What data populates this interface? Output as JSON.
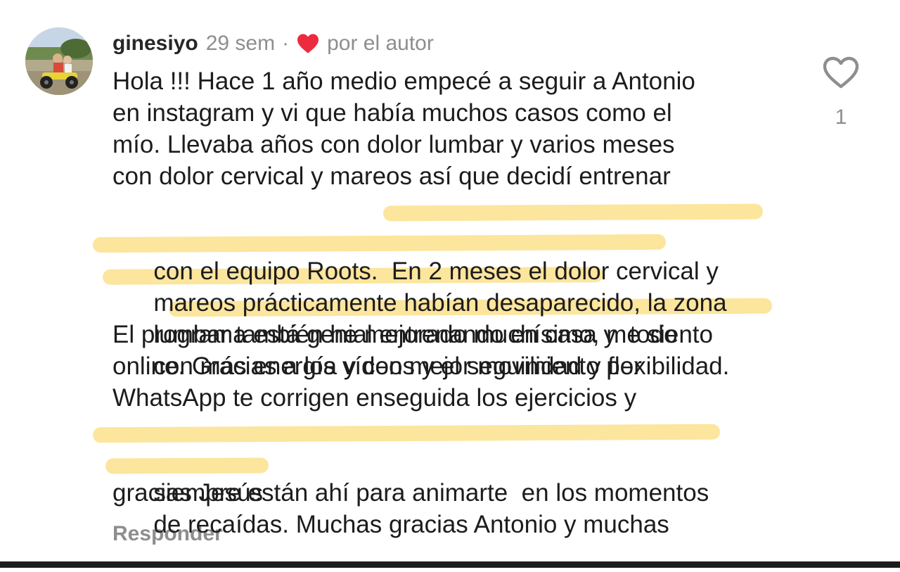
{
  "comment": {
    "username": "ginesiyo",
    "time_ago": "29 sem",
    "separator": "·",
    "author_like_label": "por el autor",
    "author_like_icon": "red-heart-icon",
    "text_lines": [
      "Hola !!! Hace 1 año medio empecé a seguir a Antonio",
      "en instagram y vi que había muchos casos como el",
      "mío. Llevaba años con dolor lumbar y varios meses",
      "con dolor cervical y mareos así que decidí entrenar",
      "con el equipo Roots.  En 2 meses el dolor cervical y",
      "mareos prácticamente habían desaparecido, la zona",
      "lumbar también he mejorado muchísimo, me siento",
      "con más energía y con mejor movilidad y flexibilidad.",
      "El programa está genial entrenando en casa y  todo",
      "online. Gracias a los vídeos y el seguimiento por",
      "WhatsApp te corrigen enseguida los ejercicios y",
      "siempre están ahí para animarte  en los momentos",
      "de recaídas. Muchas gracias Antonio y muchas",
      "gracias Jesús"
    ],
    "reply_label": "Responder",
    "like_count": "1",
    "like_icon": "heart-outline-icon",
    "highlight_color": "#fbe08c",
    "author_heart_color": "#ed2b3f",
    "meta_color": "#8e8e8e"
  }
}
